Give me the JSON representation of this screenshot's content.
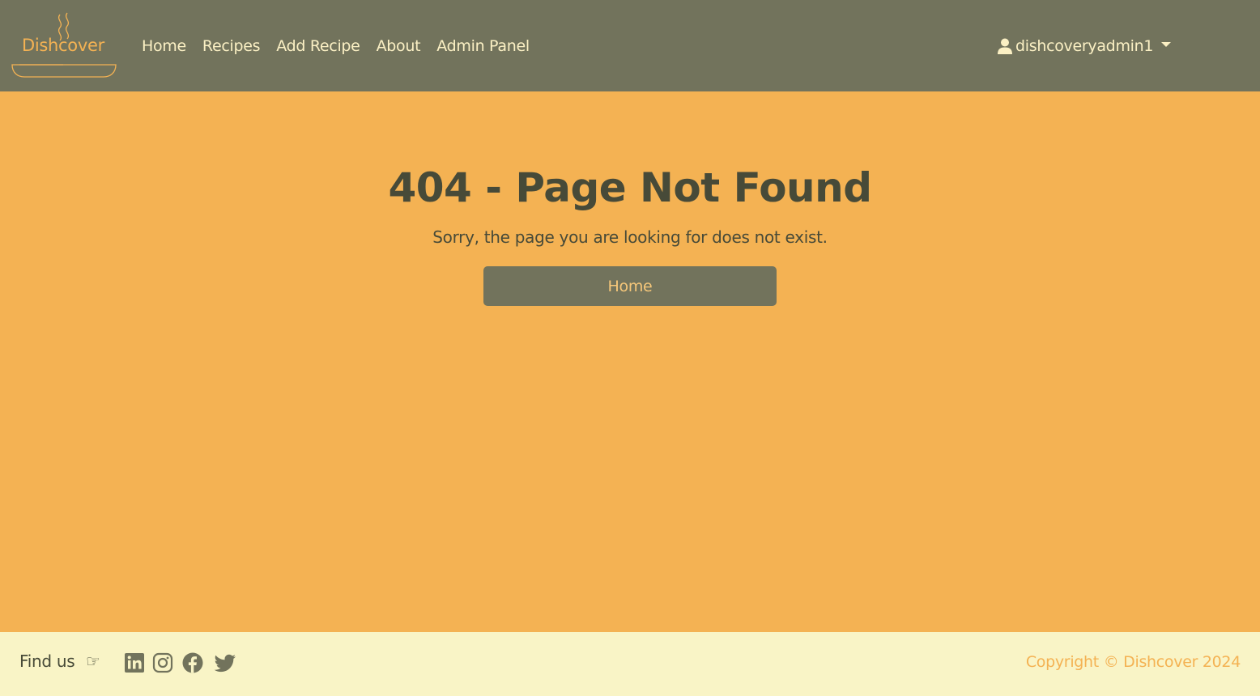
{
  "brand": {
    "logo_text": "Dishcover"
  },
  "nav": {
    "items": [
      {
        "label": "Home"
      },
      {
        "label": "Recipes"
      },
      {
        "label": "Add Recipe"
      },
      {
        "label": "About"
      },
      {
        "label": "Admin Panel"
      }
    ]
  },
  "user_menu": {
    "username": "dishcoveryadmin1",
    "icon": "user-icon",
    "toggle_icon": "caret-down-icon"
  },
  "error": {
    "title": "404 - Page Not Found",
    "message": "Sorry, the page you are looking for does not exist.",
    "button_label": "Home"
  },
  "footer": {
    "find_us": "Find us",
    "pointer": "☞",
    "social_icons": [
      "linkedin-icon",
      "instagram-icon",
      "facebook-icon",
      "twitter-icon"
    ],
    "copyright": "Copyright © Dishcover 2024"
  },
  "colors": {
    "navbar_bg": "#72735C",
    "page_bg": "#F4B253",
    "footer_bg": "#F9F4C6",
    "nav_text": "#FBF0C4",
    "heading_text": "#474A38",
    "button_text": "#F6C77A"
  }
}
